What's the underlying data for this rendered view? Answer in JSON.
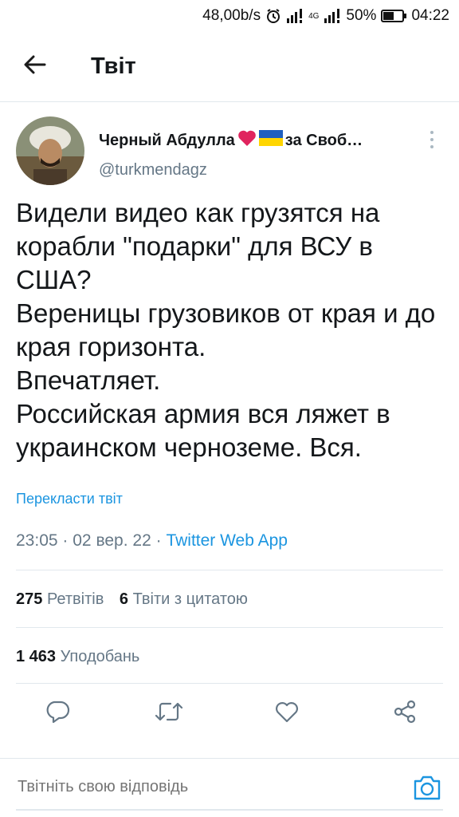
{
  "status_bar": {
    "network_speed": "48,00b/s",
    "network_type": "4G",
    "battery": "50%",
    "time": "04:22",
    "icons": [
      "alarm-icon",
      "signal-icon",
      "battery-icon"
    ]
  },
  "header": {
    "title": "Твіт",
    "back_icon": "arrow-left-icon"
  },
  "tweet": {
    "author_name": "Черный Абдулла",
    "author_name_suffix": "за Своб…",
    "author_handle": "@turkmendagz",
    "lines": [
      "Видели видео как грузятся на корабли \"подарки\" для ВСУ в США?",
      "Вереницы грузовиков от края и до края горизонта.",
      "Впечатляет.",
      "Российская армия вся ляжет в украинском черноземе. Вся."
    ],
    "translate_label": "Перекласти твіт",
    "time": "23:05",
    "date": "02 вер. 22",
    "source": "Twitter Web App",
    "separator": "·"
  },
  "stats": {
    "retweets_count": "275",
    "retweets_label": "Ретвітів",
    "quotes_count": "6",
    "quotes_label": "Твіти з цитатою",
    "likes_count": "1 463",
    "likes_label": "Уподобань"
  },
  "actions": {
    "icons": [
      "reply-icon",
      "retweet-icon",
      "like-icon",
      "share-icon"
    ]
  },
  "reply": {
    "placeholder": "Твітніть свою відповідь",
    "camera_icon": "camera-icon"
  },
  "colors": {
    "accent": "#1b95e0",
    "text": "#14171a",
    "secondary": "#657786",
    "divider": "#e1e8ed",
    "heart": "#e0245e"
  }
}
